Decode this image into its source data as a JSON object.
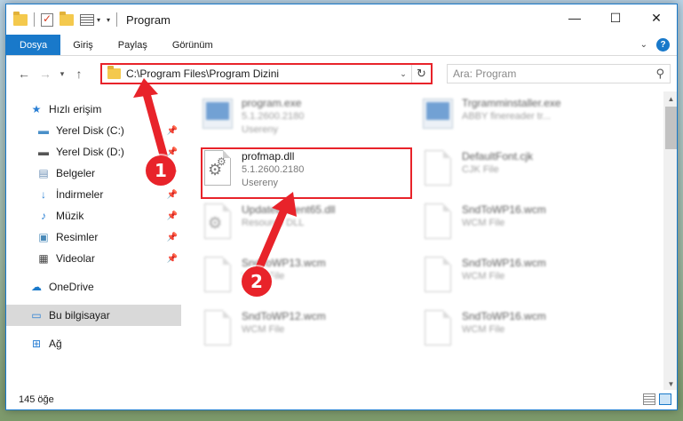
{
  "window": {
    "title": "Program",
    "controls": {
      "minimize": "—",
      "maximize": "☐",
      "close": "✕"
    }
  },
  "ribbon": {
    "tabs": [
      "Dosya",
      "Giriş",
      "Paylaş",
      "Görünüm"
    ],
    "accent": "#1979ca"
  },
  "nav": {
    "address": "C:\\Program Files\\Program Dizini",
    "search_placeholder": "Ara: Program"
  },
  "sidebar": {
    "items": [
      {
        "label": "Hızlı erişim",
        "icon": "star-icon",
        "pinned": false
      },
      {
        "label": "Yerel Disk (C:)",
        "icon": "drive-c-icon",
        "pinned": true
      },
      {
        "label": "Yerel Disk (D:)",
        "icon": "drive-d-icon",
        "pinned": true
      },
      {
        "label": "Belgeler",
        "icon": "documents-icon",
        "pinned": true
      },
      {
        "label": "İndirmeler",
        "icon": "download-icon",
        "pinned": true
      },
      {
        "label": "Müzik",
        "icon": "music-icon",
        "pinned": true
      },
      {
        "label": "Resimler",
        "icon": "pictures-icon",
        "pinned": true
      },
      {
        "label": "Videolar",
        "icon": "videos-icon",
        "pinned": true
      },
      {
        "label": "OneDrive",
        "icon": "onedrive-icon",
        "pinned": false
      },
      {
        "label": "Bu bilgisayar",
        "icon": "computer-icon",
        "pinned": false,
        "selected": true
      },
      {
        "label": "Ağ",
        "icon": "network-icon",
        "pinned": false
      }
    ]
  },
  "files": [
    {
      "name": "program.exe",
      "line2": "5.1.2600.2180",
      "line3": "Usereny",
      "type": "exe",
      "blurred": true
    },
    {
      "name": "Trgramminstaller.exe",
      "line2": "ABBY finereader tr...",
      "line3": "",
      "type": "exe",
      "blurred": true
    },
    {
      "name": "profmap.dll",
      "line2": "5.1.2600.2180",
      "line3": "Usereny",
      "type": "dll",
      "blurred": false
    },
    {
      "name": "DefaultFont.cjk",
      "line2": "CJK File",
      "line3": "",
      "type": "doc",
      "blurred": true
    },
    {
      "name": "Updatebuilient65.dll",
      "line2": "Resource DLL",
      "line3": "",
      "type": "dll",
      "blurred": true
    },
    {
      "name": "SndToWP16.wcm",
      "line2": "WCM File",
      "line3": "",
      "type": "doc",
      "blurred": true
    },
    {
      "name": "SndToWP13.wcm",
      "line2": "WCM File",
      "line3": "",
      "type": "doc",
      "blurred": true
    },
    {
      "name": "SndToWP16.wcm",
      "line2": "WCM File",
      "line3": "",
      "type": "doc",
      "blurred": true
    },
    {
      "name": "SndToWP12.wcm",
      "line2": "WCM File",
      "line3": "",
      "type": "doc",
      "blurred": true
    },
    {
      "name": "SndToWP16.wcm",
      "line2": "WCM File",
      "line3": "",
      "type": "doc",
      "blurred": true
    }
  ],
  "status": {
    "count": "145 öğe"
  },
  "callouts": [
    "1",
    "2"
  ],
  "colors": {
    "highlight": "#e8232a",
    "selection": "#d9d9d9"
  }
}
